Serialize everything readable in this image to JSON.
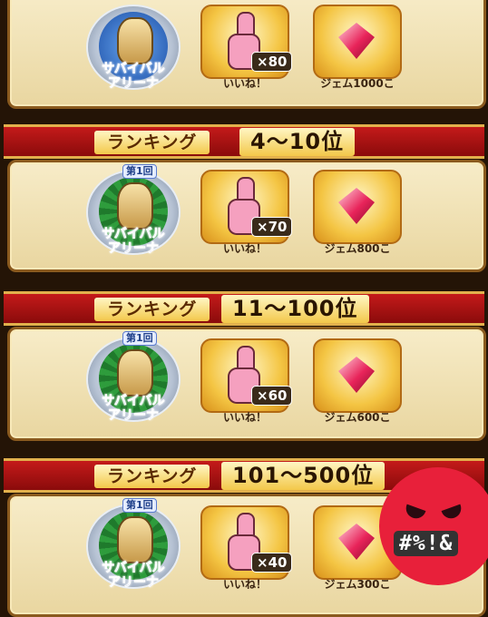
{
  "tiers": [
    {
      "range": "",
      "emblem": {
        "badge": "",
        "name_line1": "サバイバル",
        "name_line2": "アリーナ",
        "style": "blue"
      },
      "likes": {
        "count": "×80",
        "caption": "いいね！"
      },
      "gems": {
        "caption": "ジェム1000こ"
      }
    },
    {
      "banner_label": "ランキング",
      "range": "4〜10位",
      "emblem": {
        "badge": "第1回",
        "name_line1": "サバイバル",
        "name_line2": "アリーナ",
        "style": "green"
      },
      "likes": {
        "count": "×70",
        "caption": "いいね！"
      },
      "gems": {
        "caption": "ジェム800こ"
      }
    },
    {
      "banner_label": "ランキング",
      "range": "11〜100位",
      "emblem": {
        "badge": "第1回",
        "name_line1": "サバイバル",
        "name_line2": "アリーナ",
        "style": "green"
      },
      "likes": {
        "count": "×60",
        "caption": "いいね！"
      },
      "gems": {
        "caption": "ジェム600こ"
      }
    },
    {
      "banner_label": "ランキング",
      "range": "101〜500位",
      "emblem": {
        "badge": "第1回",
        "name_line1": "サバイバル",
        "name_line2": "アリーナ",
        "style": "green"
      },
      "likes": {
        "count": "×40",
        "caption": "いいね！"
      },
      "gems": {
        "caption": "ジェム300こ"
      }
    }
  ],
  "overlay": {
    "icon": "angry-face-icon",
    "grawlix": "#%!&"
  },
  "colors": {
    "banner": "#b01414",
    "panel": "#f1e2b4",
    "angry": "#e8203a"
  }
}
